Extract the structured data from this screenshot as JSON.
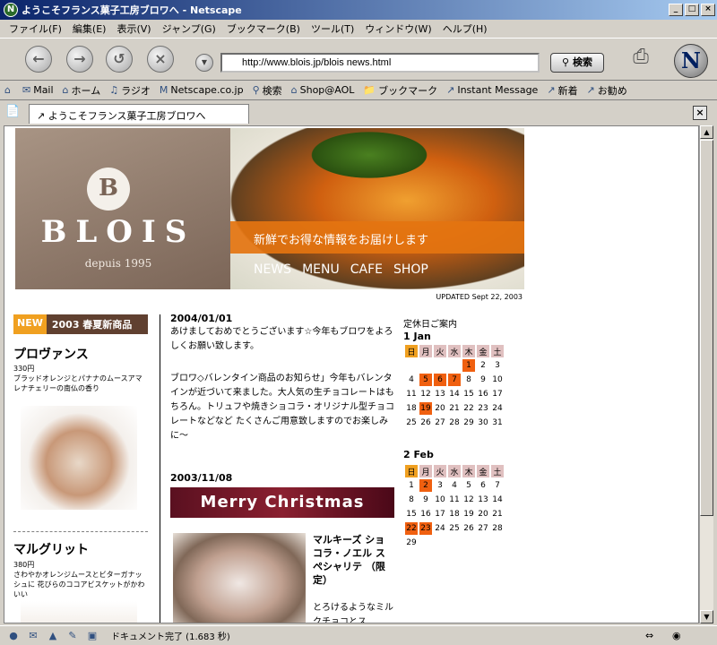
{
  "window": {
    "title": "ようこそフランス菓子工房ブロワへ - Netscape",
    "app_icon": "N"
  },
  "menu": [
    "ファイル(F)",
    "編集(E)",
    "表示(V)",
    "ジャンプ(G)",
    "ブックマーク(B)",
    "ツール(T)",
    "ウィンドウ(W)",
    "ヘルプ(H)"
  ],
  "navigation": {
    "url": "http://www.blois.jp/blois news.html",
    "search_label": "検索"
  },
  "personal_toolbar": [
    "Mail",
    "ホーム",
    "ラジオ",
    "Netscape.co.jp",
    "検索",
    "Shop@AOL",
    "ブックマーク",
    "Instant Message",
    "新着",
    "お勧め"
  ],
  "tab": {
    "label": "ようこそフランス菓子工房ブロワへ"
  },
  "status": {
    "text": "ドキュメント完了 (1.683 秒)"
  },
  "page": {
    "hero": {
      "logo_letter": "B",
      "brand": "BLOIS",
      "since": "depuis 1995",
      "tagline": "新鮮でお得な情報をお届けします",
      "nav": [
        "NEWS",
        "MENU",
        "CAFE",
        "SHOP"
      ]
    },
    "updated": "UPDATED Sept 22, 2003",
    "new_badge": {
      "new": "NEW",
      "label": "2003 春夏新商品"
    },
    "products": [
      {
        "name": "プロヴァンス",
        "price": "330円",
        "desc": "ブラッドオレンジとパナナのムースアマレナチェリーの南仏の香り"
      },
      {
        "name": "マルグリット",
        "price": "380円",
        "desc": "さわやかオレンジムースとビターガナッシュに 花びらのココアビスケットがかわいい"
      }
    ],
    "posts": [
      {
        "date": "2004/01/01",
        "text": "あけましておめでとうございます☆今年もブロワをよろしくお願い致します。"
      },
      {
        "text": "ブロワ◇バレンタイン商品のお知らせ」今年もバレンタインが近づいて来ました。大人気の生チョコレートはもちろん。トリュフや焼きショコラ・オリジナル型チョコレートなどなど たくさんご用意致しますのでお楽しみに〜"
      },
      {
        "date": "2003/11/08",
        "banner": "Merry Christmas"
      }
    ],
    "cake": {
      "title": "マルキーズ ショコラ・ノエル スペシャリテ （限定）",
      "desc": "とろけるようなミルクチョコとス"
    },
    "calendar": {
      "heading": "定休日ご案内",
      "weekdays": [
        "日",
        "月",
        "火",
        "水",
        "木",
        "金",
        "土"
      ],
      "months": [
        {
          "label": "1  Jan",
          "weeks": [
            [
              "",
              "",
              "",
              "",
              "1",
              "2",
              "3"
            ],
            [
              "4",
              "5",
              "6",
              "7",
              "8",
              "9",
              "10"
            ],
            [
              "11",
              "12",
              "13",
              "14",
              "15",
              "16",
              "17"
            ],
            [
              "18",
              "19",
              "20",
              "21",
              "22",
              "23",
              "24"
            ],
            [
              "25",
              "26",
              "27",
              "28",
              "29",
              "30",
              "31"
            ]
          ],
          "holidays": [
            "1",
            "5",
            "6",
            "7",
            "19"
          ]
        },
        {
          "label": "2  Feb",
          "weeks": [
            [
              "1",
              "2",
              "3",
              "4",
              "5",
              "6",
              "7"
            ],
            [
              "8",
              "9",
              "10",
              "11",
              "12",
              "13",
              "14"
            ],
            [
              "15",
              "16",
              "17",
              "18",
              "19",
              "20",
              "21"
            ],
            [
              "22",
              "23",
              "24",
              "25",
              "26",
              "27",
              "28"
            ],
            [
              "29",
              "",
              "",
              "",
              "",
              "",
              ""
            ]
          ],
          "holidays": [
            "2",
            "22",
            "23"
          ]
        }
      ]
    }
  }
}
